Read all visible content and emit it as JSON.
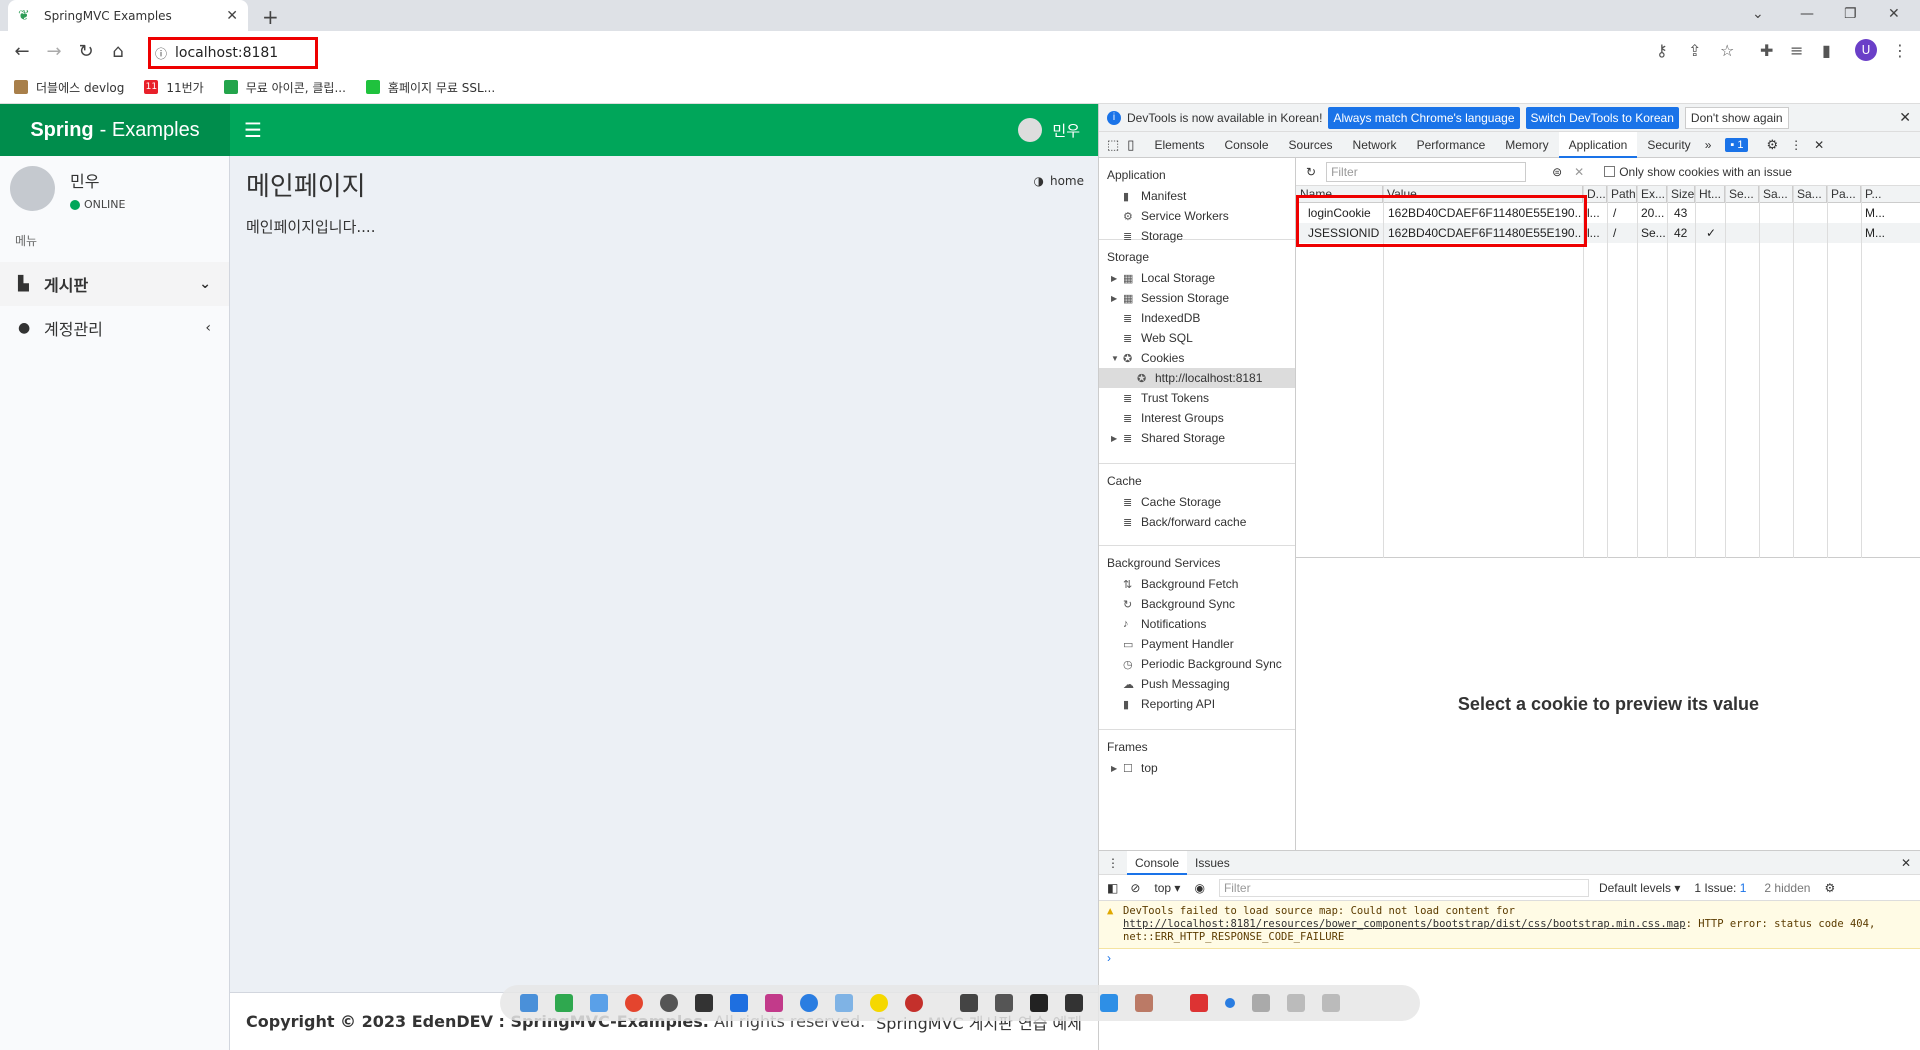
{
  "browser": {
    "tab_title": "SpringMVC Examples",
    "url": "localhost:8181",
    "profile_initial": "U",
    "bookmarks": [
      "더블에스 devlog",
      "11번가",
      "무료 아이콘, 클립...",
      "홈페이지 무료 SSL..."
    ]
  },
  "app": {
    "logo_bold": "Spring",
    "logo_rest": "- Examples",
    "header_user": "민우",
    "sidebar_user": "민우",
    "status": "ONLINE",
    "menu_header": "메뉴",
    "menu": [
      "게시판",
      "계정관리"
    ],
    "page_title": "메인페이지",
    "breadcrumb": "home",
    "body_text": "메인페이지입니다....",
    "footer_copy_bold": "Copyright © 2023 EdenDEV : SpringMVC-Examples.",
    "footer_copy_rest": "All rights reserved.",
    "footer_right": "SpringMVC 게시판 연습 예제"
  },
  "devtools": {
    "info_text": "DevTools is now available in Korean!",
    "btn_match": "Always match Chrome's language",
    "btn_switch": "Switch DevTools to Korean",
    "btn_dont": "Don't show again",
    "tabs": [
      "Elements",
      "Console",
      "Sources",
      "Network",
      "Performance",
      "Memory",
      "Application",
      "Security"
    ],
    "issues_count": "1",
    "nav": {
      "application": {
        "header": "Application",
        "items": [
          "Manifest",
          "Service Workers",
          "Storage"
        ]
      },
      "storage": {
        "header": "Storage",
        "items": [
          "Local Storage",
          "Session Storage",
          "IndexedDB",
          "Web SQL",
          "Cookies",
          "http://localhost:8181",
          "Trust Tokens",
          "Interest Groups",
          "Shared Storage"
        ]
      },
      "cache": {
        "header": "Cache",
        "items": [
          "Cache Storage",
          "Back/forward cache"
        ]
      },
      "background": {
        "header": "Background Services",
        "items": [
          "Background Fetch",
          "Background Sync",
          "Notifications",
          "Payment Handler",
          "Periodic Background Sync",
          "Push Messaging",
          "Reporting API"
        ]
      },
      "frames": {
        "header": "Frames",
        "items": [
          "top"
        ]
      }
    },
    "filter_placeholder": "Filter",
    "only_issue_label": "Only show cookies with an issue",
    "columns": [
      "Name",
      "Value",
      "D...",
      "Path",
      "Ex...",
      "Size",
      "Ht...",
      "Se...",
      "Sa...",
      "Sa...",
      "Pa...",
      "P..."
    ],
    "rows": [
      [
        "loginCookie",
        "162BD40CDAEF6F11480E55E190...",
        "l...",
        "/",
        "20...",
        "43",
        "",
        "",
        "",
        "",
        "",
        "M..."
      ],
      [
        "JSESSIONID",
        "162BD40CDAEF6F11480E55E190...",
        "l...",
        "/",
        "Se...",
        "42",
        "✓",
        "",
        "",
        "",
        "",
        "M..."
      ]
    ],
    "preview_text": "Select a cookie to preview its value",
    "drawer": {
      "tabs": [
        "Console",
        "Issues"
      ],
      "context": "top",
      "filter_placeholder": "Filter",
      "levels": "Default levels",
      "issue_count": "1 Issue:",
      "issue_num": "1",
      "hidden": "2 hidden",
      "msg_prefix": "DevTools failed to load source map: Could not load content for ",
      "msg_link": "http://localhost:8181/resources/bower_components/bootstrap/dist/css/bootstrap.min.css.map",
      "msg_suffix": ": HTTP error: status code 404, net::ERR_HTTP_RESPONSE_CODE_FAILURE",
      "prompt": "›"
    }
  },
  "colors": {
    "brand_green": "#00a65a",
    "highlight_red": "#e00000",
    "accent_blue": "#1a73e8"
  }
}
